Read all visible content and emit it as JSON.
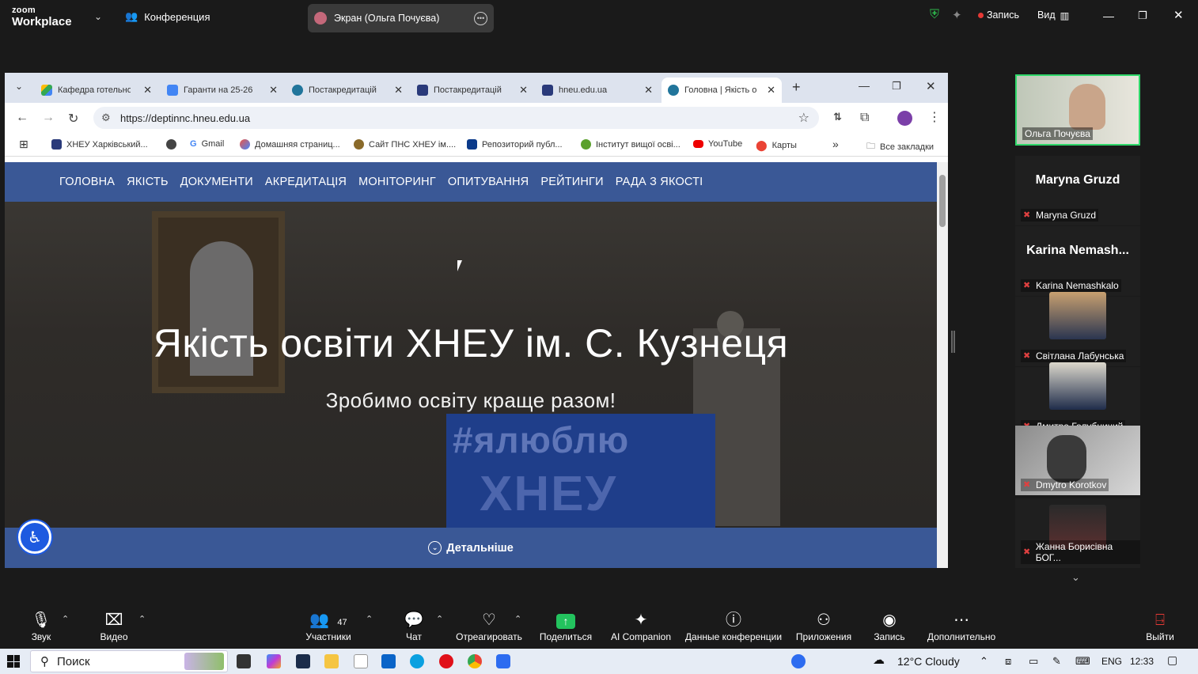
{
  "zoom": {
    "logo_top": "zoom",
    "logo_bottom": "Workplace",
    "conference": "Конференция",
    "screen_share": "Экран (Ольга Почуєва)",
    "record": "Запись",
    "view": "Вид"
  },
  "browser": {
    "tabs": [
      {
        "title": "Кафедра готельно",
        "color": "#1a73e8"
      },
      {
        "title": "Гаранти на 25-26",
        "color": "#4285f4"
      },
      {
        "title": "Постакредитацій",
        "color": "#21759b"
      },
      {
        "title": "Постакредитацій",
        "color": "#2a3a7a"
      },
      {
        "title": "hneu.edu.ua",
        "color": "#2a3a7a"
      },
      {
        "title": "Головна | Якість о",
        "color": "#21759b"
      }
    ],
    "url": "https://deptinnc.hneu.edu.ua",
    "bookmarks": [
      "ХНЕУ Харківський...",
      "Gmail",
      "Домашняя страниц...",
      "Сайт ПНС ХНЕУ ім....",
      "Репозиторий публ...",
      "Інститут вищої осві...",
      "YouTube",
      "Карты"
    ],
    "bookmark_more": "»",
    "all_bookmarks": "Все закладки"
  },
  "site": {
    "menu": [
      "ГОЛОВНА",
      "ЯКІСТЬ",
      "ДОКУМЕНТИ",
      "АКРЕДИТАЦІЯ",
      "МОНІТОРИНГ",
      "ОПИТУВАННЯ",
      "РЕЙТИНГИ",
      "РАДА З ЯКОСТІ"
    ],
    "hero_title": "Якість освіти ХНЕУ ім. С. Кузнеця",
    "hero_subtitle": "Зробимо освіту краще разом!",
    "banner_line1": "#ялюблю",
    "banner_line2": "ХНЕУ",
    "more": "Детальніше"
  },
  "participants": [
    {
      "name": "Ольга Почуєва",
      "big": "",
      "muted": false
    },
    {
      "name": "Maryna Gruzd",
      "big": "Maryna Gruzd",
      "muted": true
    },
    {
      "name": "Karina Nemashkalo",
      "big": "Karina  Nemash...",
      "muted": true
    },
    {
      "name": "Світлана Лабунська",
      "big": "",
      "muted": true
    },
    {
      "name": "Дмитро Голубничий",
      "big": "",
      "muted": true
    },
    {
      "name": "Dmytro Korotkov",
      "big": "",
      "muted": true
    },
    {
      "name": "Жанна Борисівна БОГ...",
      "big": "",
      "muted": true
    }
  ],
  "toolbar": {
    "audio": "Звук",
    "video": "Видео",
    "participants": "Участники",
    "participants_count": "47",
    "chat": "Чат",
    "react": "Отреагировать",
    "share": "Поделиться",
    "ai": "AI Companion",
    "info": "Данные конференции",
    "apps": "Приложения",
    "record": "Запись",
    "more": "Дополнительно",
    "leave": "Выйти"
  },
  "taskbar": {
    "search": "Поиск",
    "weather": "12°C  Cloudy",
    "lang": "ENG",
    "time": "12:33"
  }
}
